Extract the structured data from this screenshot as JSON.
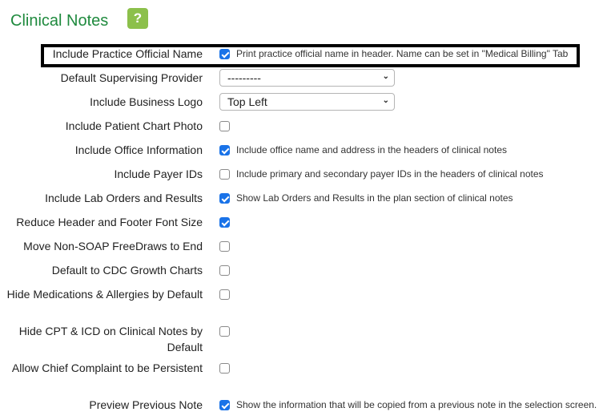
{
  "section": {
    "title": "Clinical Notes",
    "help_label": "?"
  },
  "settings": [
    {
      "label": "Include Practice Official Name",
      "type": "checkbox",
      "checked": true,
      "description": "Print practice official name in header. Name can be set in \"Medical Billing\" Tab"
    },
    {
      "label": "Default Supervising Provider",
      "type": "select",
      "value": "---------"
    },
    {
      "label": "Include Business Logo",
      "type": "select",
      "value": "Top Left"
    },
    {
      "label": "Include Patient Chart Photo",
      "type": "checkbox",
      "checked": false,
      "description": ""
    },
    {
      "label": "Include Office Information",
      "type": "checkbox",
      "checked": true,
      "description": "Include office name and address in the headers of clinical notes"
    },
    {
      "label": "Include Payer IDs",
      "type": "checkbox",
      "checked": false,
      "description": "Include primary and secondary payer IDs in the headers of clinical notes"
    },
    {
      "label": "Include Lab Orders and Results",
      "type": "checkbox",
      "checked": true,
      "description": "Show Lab Orders and Results in the plan section of clinical notes"
    },
    {
      "label": "Reduce Header and Footer Font Size",
      "type": "checkbox",
      "checked": true,
      "description": ""
    },
    {
      "label": "Move Non-SOAP FreeDraws to End",
      "type": "checkbox",
      "checked": false,
      "description": ""
    },
    {
      "label": "Default to CDC Growth Charts",
      "type": "checkbox",
      "checked": false,
      "description": ""
    },
    {
      "label": "Hide Medications & Allergies by Default",
      "type": "checkbox",
      "checked": false,
      "description": ""
    },
    {
      "label": "Hide CPT & ICD on Clinical Notes by Default",
      "type": "checkbox",
      "checked": false,
      "description": ""
    },
    {
      "label": "Allow Chief Complaint to be Persistent",
      "type": "checkbox",
      "checked": false,
      "description": ""
    },
    {
      "label": "Preview Previous Note",
      "type": "checkbox",
      "checked": true,
      "description": "Show the information that will be copied from a previous note in the selection screen."
    }
  ],
  "colors": {
    "title": "#1f8a3e",
    "help_bg": "#8cc04b",
    "checkbox_on": "#1a73e8"
  }
}
